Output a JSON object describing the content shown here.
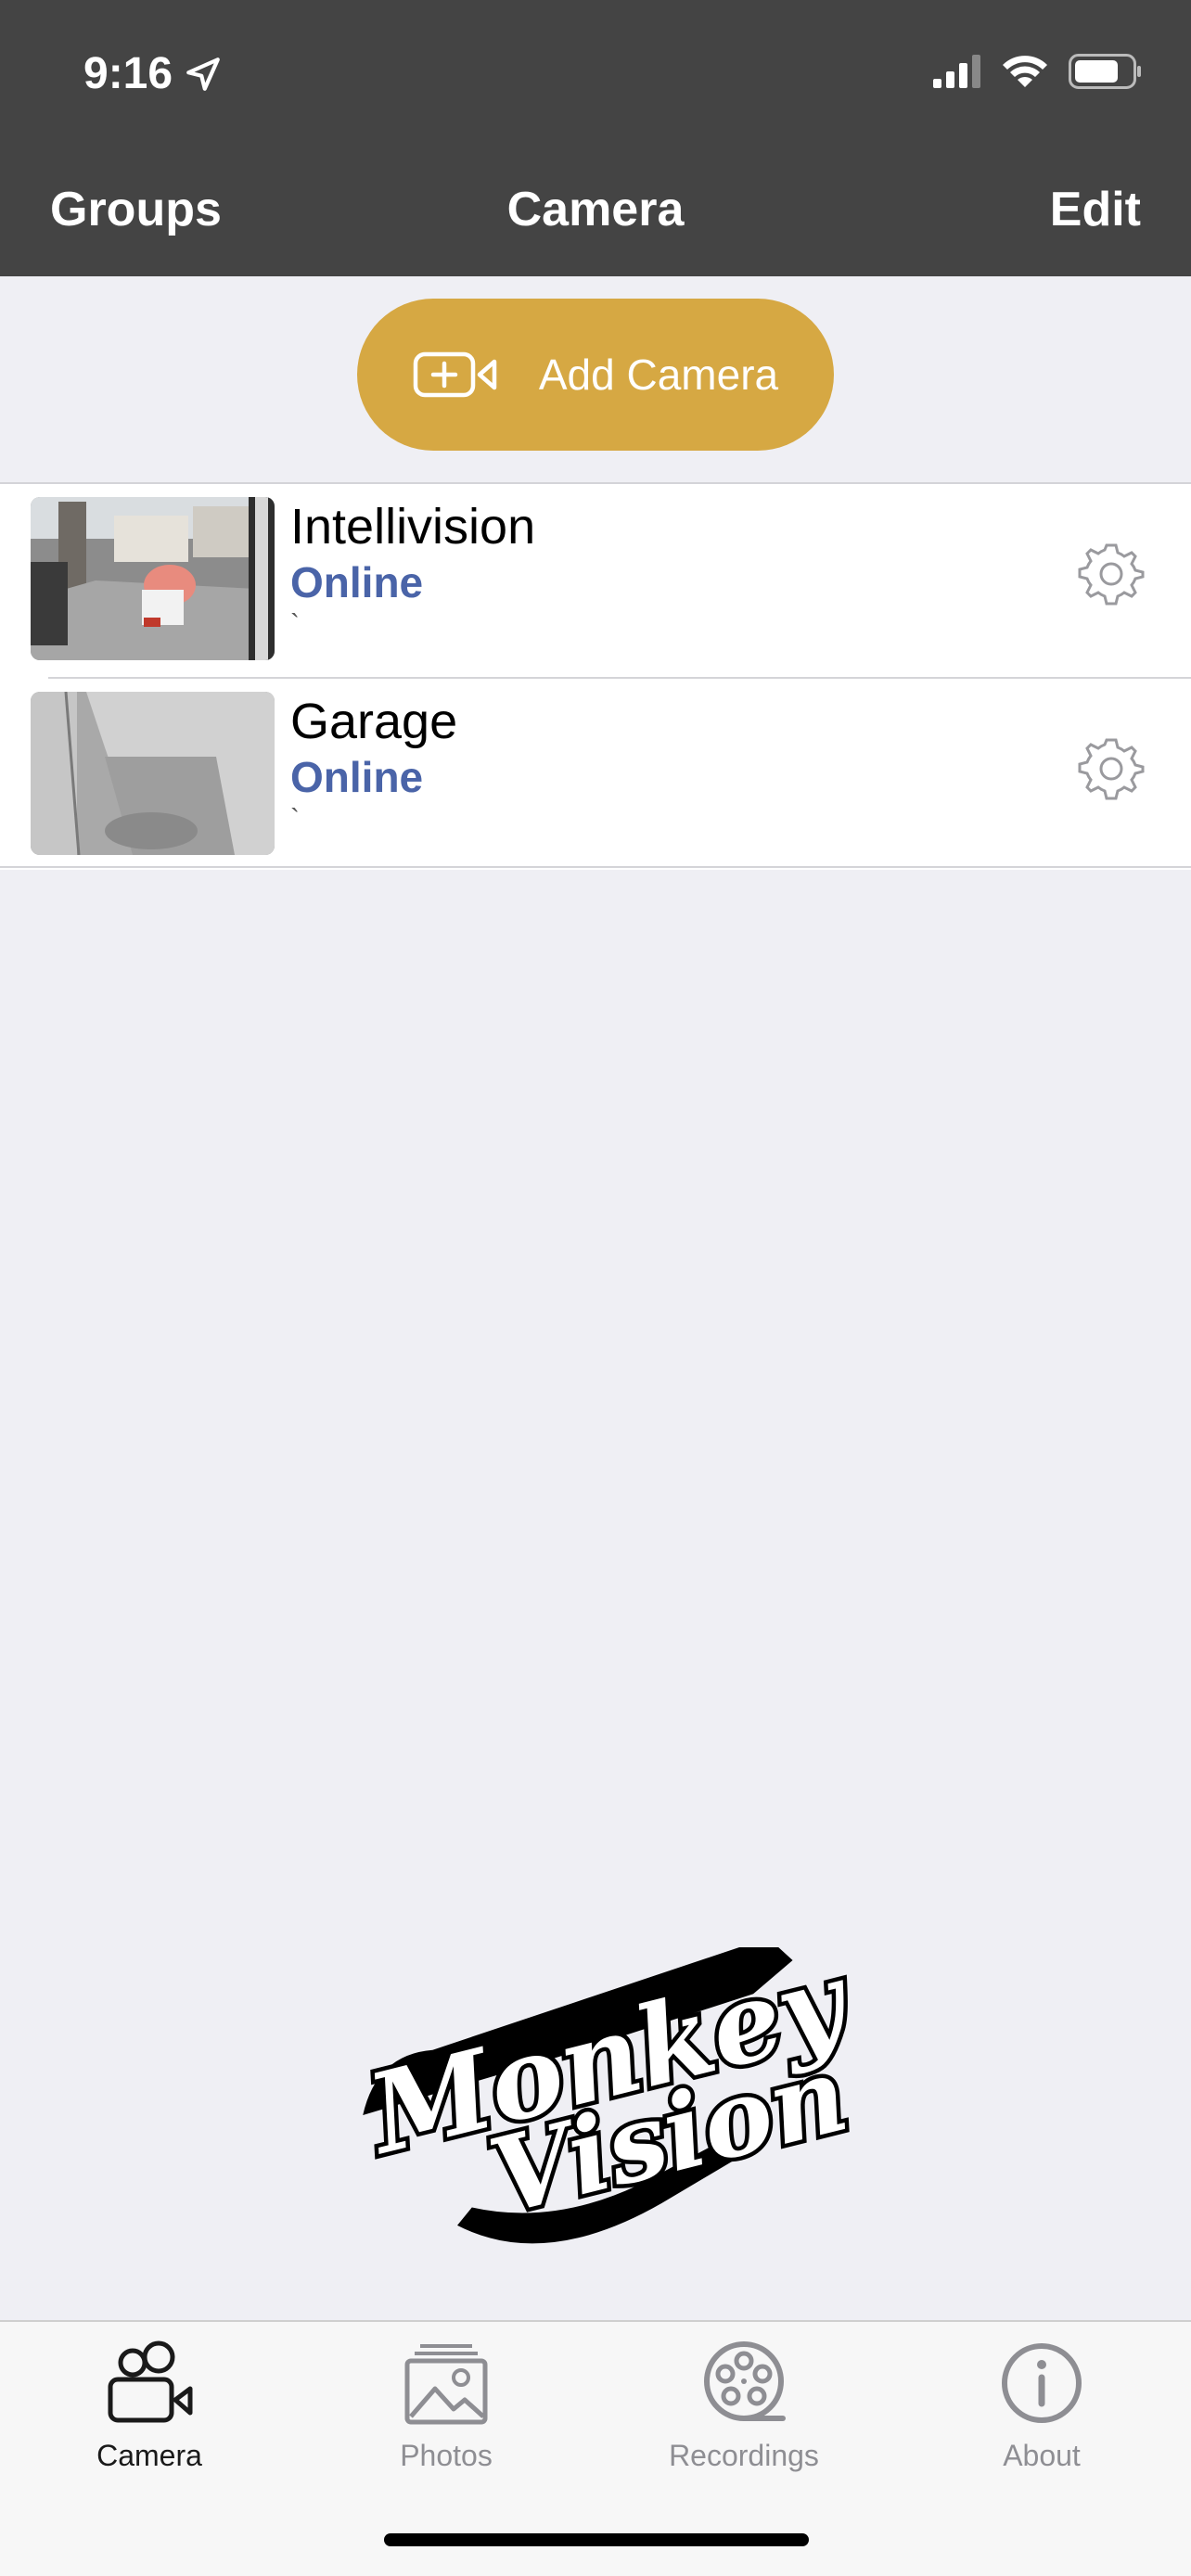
{
  "status_bar": {
    "time": "9:16"
  },
  "nav": {
    "left": "Groups",
    "title": "Camera",
    "right": "Edit"
  },
  "add_camera": {
    "label": "Add Camera"
  },
  "cameras": [
    {
      "name": "Intellivision",
      "status": "Online",
      "extra": "`"
    },
    {
      "name": "Garage",
      "status": "Online",
      "extra": "`"
    }
  ],
  "tabs": [
    {
      "label": "Camera",
      "active": true
    },
    {
      "label": "Photos",
      "active": false
    },
    {
      "label": "Recordings",
      "active": false
    },
    {
      "label": "About",
      "active": false
    }
  ],
  "logo": {
    "text": "Monkey Vision"
  },
  "colors": {
    "nav_bg": "#444444",
    "accent": "#d6a843",
    "status_online": "#4a64a8",
    "bg": "#efeff4"
  }
}
